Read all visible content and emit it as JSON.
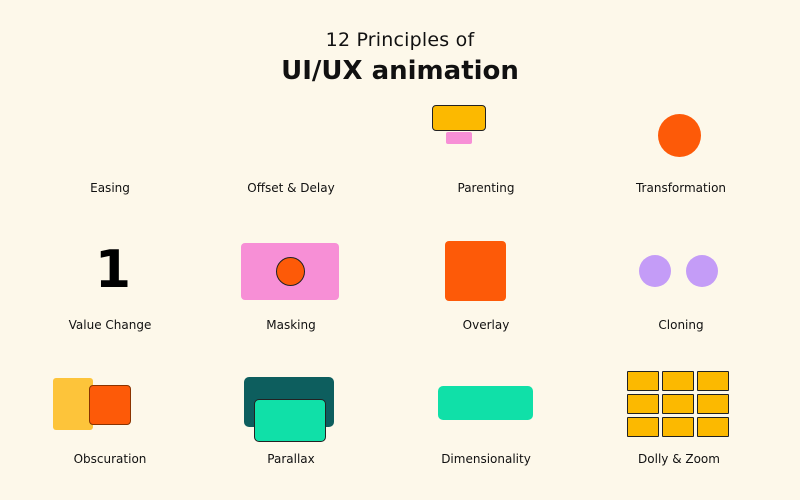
{
  "title": {
    "line1": "12 Principles of",
    "line2": "UI/UX animation"
  },
  "principles": [
    {
      "label": "Easing"
    },
    {
      "label": "Offset & Delay"
    },
    {
      "label": "Parenting"
    },
    {
      "label": "Transformation"
    },
    {
      "label": "Value Change",
      "graphic_text": "1"
    },
    {
      "label": "Masking"
    },
    {
      "label": "Overlay"
    },
    {
      "label": "Cloning"
    },
    {
      "label": "Obscuration"
    },
    {
      "label": "Parallax"
    },
    {
      "label": "Dimensionality"
    },
    {
      "label": "Dolly & Zoom"
    }
  ],
  "colors": {
    "background": "#fdf8ea",
    "yellow": "#fcb900",
    "light_yellow": "#fdc43a",
    "pink": "#f78fd6",
    "orange": "#fd5a08",
    "lavender": "#c49cf7",
    "dark_teal": "#0d5e5e",
    "mint": "#10e0a8",
    "ink": "#111111"
  }
}
